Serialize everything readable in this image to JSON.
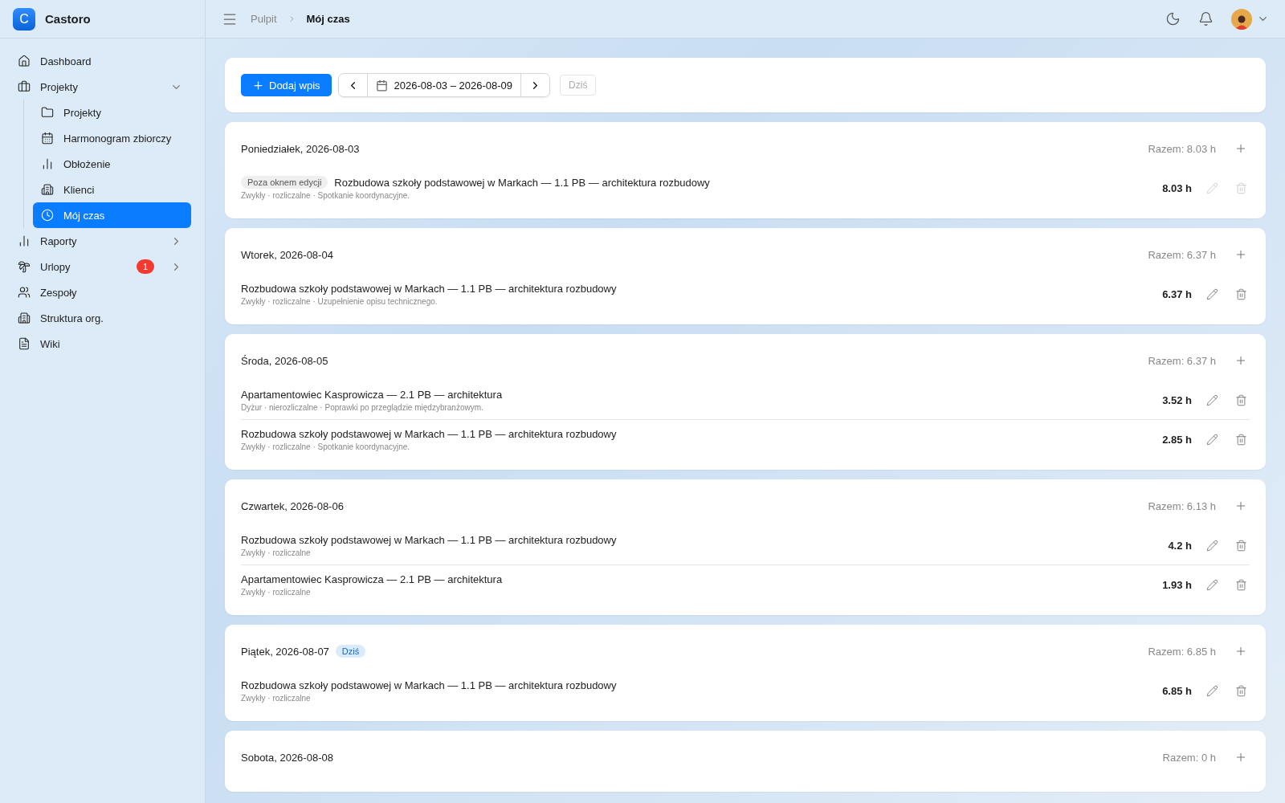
{
  "brand": {
    "logo": "C",
    "name": "Castoro"
  },
  "breadcrumb": [
    {
      "label": "Pulpit",
      "selected": false
    },
    {
      "label": "Mój czas",
      "selected": true
    }
  ],
  "sidebar": {
    "items": [
      {
        "label": "Dashboard",
        "selected": false
      },
      {
        "label": "Projekty",
        "selected": false,
        "expanded": true,
        "children": [
          {
            "label": "Projekty",
            "selected": false
          },
          {
            "label": "Harmonogram zbiorczy",
            "selected": false
          },
          {
            "label": "Obłożenie",
            "selected": false
          },
          {
            "label": "Klienci",
            "selected": false
          },
          {
            "label": "Mój czas",
            "selected": true
          }
        ]
      },
      {
        "label": "Raporty",
        "selected": false,
        "expanded": false
      },
      {
        "label": "Urlopy",
        "selected": false,
        "expanded": false,
        "badge": "1"
      },
      {
        "label": "Zespoły",
        "selected": false
      },
      {
        "label": "Struktura org.",
        "selected": false
      },
      {
        "label": "Wiki",
        "selected": false
      }
    ]
  },
  "toolbar": {
    "add_button": "Dodaj wpis",
    "date_range": "2026-08-03 – 2026-08-09",
    "today_button": "Dziś",
    "today_disabled": true
  },
  "days": [
    {
      "label": "Poniedziałek, 2026-08-03",
      "total": "Razem: 8.03 h",
      "entries": [
        {
          "tag": "Poza oknem edycji",
          "title": "Rozbudowa szkoły podstawowej w Markach — 1.1 PB — architektura rozbudowy",
          "meta": "Zwykły · rozliczalne · Spotkanie koordynacyjne.",
          "hours": "8.03 h",
          "locked": true
        }
      ]
    },
    {
      "label": "Wtorek, 2026-08-04",
      "total": "Razem: 6.37 h",
      "entries": [
        {
          "title": "Rozbudowa szkoły podstawowej w Markach — 1.1 PB — architektura rozbudowy",
          "meta": "Zwykły · rozliczalne · Uzupełnienie opisu technicznego.",
          "hours": "6.37 h",
          "locked": false
        }
      ]
    },
    {
      "label": "Środa, 2026-08-05",
      "total": "Razem: 6.37 h",
      "entries": [
        {
          "title": "Apartamentowiec Kasprowicza — 2.1 PB — architektura",
          "meta": "Dyżur · nierozliczalne · Poprawki po przeglądzie międzybranżowym.",
          "hours": "3.52 h",
          "locked": false
        },
        {
          "title": "Rozbudowa szkoły podstawowej w Markach — 1.1 PB — architektura rozbudowy",
          "meta": "Zwykły · rozliczalne · Spotkanie koordynacyjne.",
          "hours": "2.85 h",
          "locked": false
        }
      ]
    },
    {
      "label": "Czwartek, 2026-08-06",
      "total": "Razem: 6.13 h",
      "entries": [
        {
          "title": "Rozbudowa szkoły podstawowej w Markach — 1.1 PB — architektura rozbudowy",
          "meta": "Zwykły · rozliczalne",
          "hours": "4.2 h",
          "locked": false
        },
        {
          "title": "Apartamentowiec Kasprowicza — 2.1 PB — architektura",
          "meta": "Zwykły · rozliczalne",
          "hours": "1.93 h",
          "locked": false
        }
      ]
    },
    {
      "label": "Piątek, 2026-08-07",
      "badge": "Dziś",
      "total": "Razem: 6.85 h",
      "entries": [
        {
          "title": "Rozbudowa szkoły podstawowej w Markach — 1.1 PB — architektura rozbudowy",
          "meta": "Zwykły · rozliczalne",
          "hours": "6.85 h",
          "locked": false
        }
      ]
    },
    {
      "label": "Sobota, 2026-08-08",
      "total": "Razem: 0 h"
    }
  ]
}
